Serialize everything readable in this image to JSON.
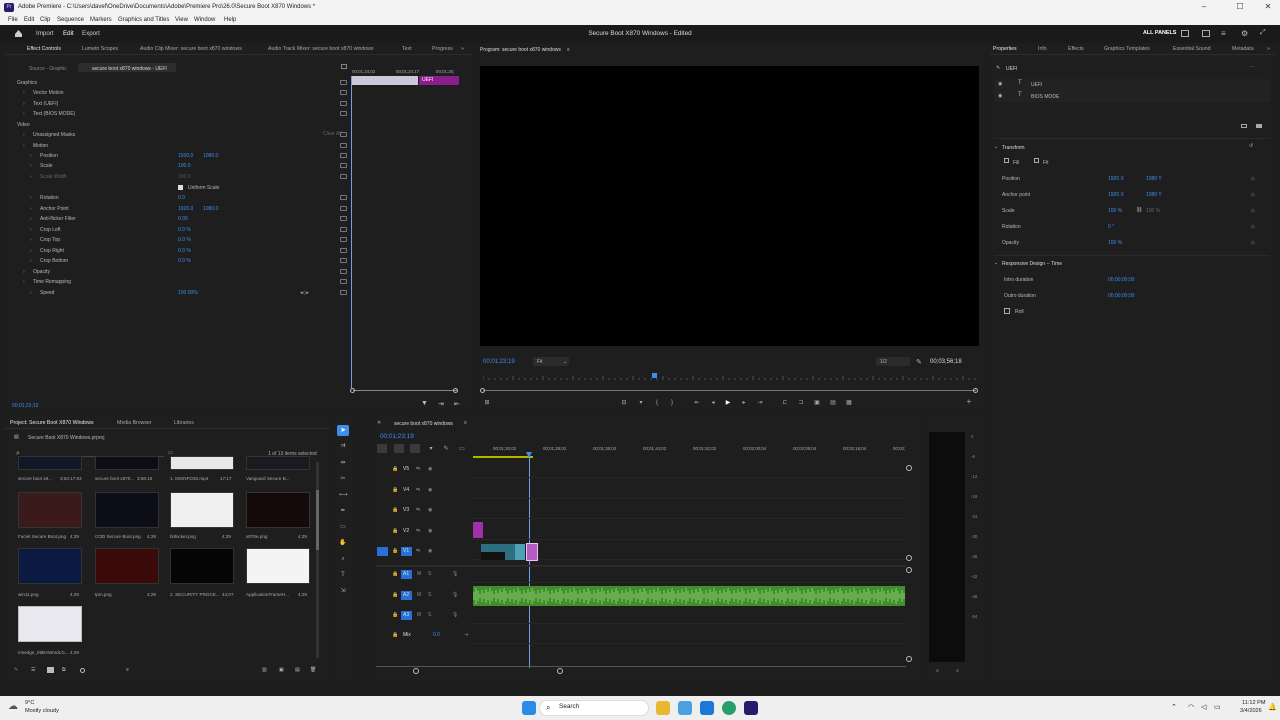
{
  "window": {
    "title": "Adobe Premiere - C:\\Users\\davef\\OneDrive\\Documents\\Adobe\\Premiere Pro\\26.0\\Secure Boot X870 Windows *",
    "app_icon": "Pr"
  },
  "menu": [
    "File",
    "Edit",
    "Clip",
    "Sequence",
    "Markers",
    "Graphics and Titles",
    "View",
    "Window",
    "Help"
  ],
  "header": {
    "tabs": [
      "Import",
      "Edit",
      "Export"
    ],
    "project_title": "Secure Boot X870 Windows - Edited",
    "all_panels": "ALL PANELS"
  },
  "effect_controls": {
    "tabs": [
      "Effect Controls",
      "Lumetri Scopes",
      "Audio Clip Mixer: secure boot x870 windows",
      "Audio Track Mixer: secure boot x870 windows",
      "Text",
      "Progress"
    ],
    "source": "Source - Graphic",
    "clip": "secure boot x870 windows - UEFI",
    "timecodes": [
      "00;01;24;02",
      "00;01;24;17",
      "00;01;25;"
    ],
    "clip_label": "UEFI",
    "rows": [
      {
        "label": "Graphics",
        "indent": 0
      },
      {
        "label": "Vector Motion",
        "indent": 1
      },
      {
        "label": "Text (UEFI)",
        "indent": 1
      },
      {
        "label": "Text (BIOS MODE)",
        "indent": 1
      },
      {
        "label": "Video",
        "indent": 0
      },
      {
        "label": "Unassigned Masks",
        "indent": 1
      },
      {
        "label": "Motion",
        "indent": 1
      },
      {
        "label": "Position",
        "indent": 2,
        "v1": "1920.0",
        "v2": "1080.0"
      },
      {
        "label": "Scale",
        "indent": 2,
        "v1": "100.0"
      },
      {
        "label": "Scale Width",
        "indent": 2,
        "v1": "100.0",
        "dim": true
      },
      {
        "label": "",
        "indent": 2,
        "check": "Uniform Scale"
      },
      {
        "label": "Rotation",
        "indent": 2,
        "v1": "0.0"
      },
      {
        "label": "Anchor Point",
        "indent": 2,
        "v1": "1920.0",
        "v2": "1080.0"
      },
      {
        "label": "Anti-flicker Filter",
        "indent": 2,
        "v1": "0.00"
      },
      {
        "label": "Crop Left",
        "indent": 2,
        "v1": "0.0 %"
      },
      {
        "label": "Crop Top",
        "indent": 2,
        "v1": "0.0 %"
      },
      {
        "label": "Crop Right",
        "indent": 2,
        "v1": "0.0 %"
      },
      {
        "label": "Crop Bottom",
        "indent": 2,
        "v1": "0.0 %"
      },
      {
        "label": "Opacity",
        "indent": 1
      },
      {
        "label": "Time Remapping",
        "indent": 1
      },
      {
        "label": "Speed",
        "indent": 2,
        "v1": "100.00%"
      }
    ],
    "clear_all": "Clear All",
    "footer_time": "00;01;23;19"
  },
  "program": {
    "title": "Program: secure boot x870 windows",
    "timecode": "00;01;23;19",
    "fit": "Fit",
    "quality": "1/2",
    "duration": "00;03;56;18"
  },
  "properties": {
    "tabs": [
      "Properties",
      "Info",
      "Effects",
      "Graphics Templates",
      "Essential Sound",
      "Metadata"
    ],
    "layer_group": "UEFI",
    "layers": [
      "UEFI",
      "BIOS MODE"
    ],
    "transform_title": "Transform",
    "fill_label": "Fill",
    "fit_label": "Fit",
    "transform": [
      {
        "label": "Position",
        "v1": "1920 X",
        "v2": "1080 Y"
      },
      {
        "label": "Anchor point",
        "v1": "1920 X",
        "v2": "1080 Y"
      },
      {
        "label": "Scale",
        "v1": "100 %",
        "v2": "100 %"
      },
      {
        "label": "Rotation",
        "v1": "0 °"
      },
      {
        "label": "Opacity",
        "v1": "100 %"
      }
    ],
    "responsive_title": "Responsive Design -- Time",
    "responsive": [
      {
        "label": "Intro duration",
        "v1": "00;00;00;00"
      },
      {
        "label": "Outro duration",
        "v1": "00;00;00;00"
      }
    ],
    "roll": "Roll"
  },
  "project": {
    "tabs": [
      "Project: Secure Boot X870 Windows",
      "Media Browser",
      "Libraries"
    ],
    "file": "Secure Boot X870 Windows.prproj",
    "selection": "1 of 13 items selected",
    "items": [
      {
        "name": "secure boot x8...",
        "dur": "3;54;17;04"
      },
      {
        "name": "secure boot x870...",
        "dur": "3;56;18"
      },
      {
        "name": "1. MSINFO32.mp4",
        "dur": "17;17"
      },
      {
        "name": "Vanguard Secure B...",
        "dur": "4;29"
      },
      {
        "name": "Faceit Secure Boot.png",
        "dur": "4;29"
      },
      {
        "name": "COD Secure Boot.png",
        "dur": "4;29"
      },
      {
        "name": "bitlocker.png",
        "dur": "4;29"
      },
      {
        "name": "x870e.png",
        "dur": "4;29"
      },
      {
        "name": "win11.png",
        "dur": "4;29"
      },
      {
        "name": "tpm.png",
        "dur": "4;29"
      },
      {
        "name": "2. SECURITY PROCE...",
        "dur": "44;07"
      },
      {
        "name": "ApplicationFrameH...",
        "dur": "4;29"
      },
      {
        "name": "msedge_rl8BAWmdLG...",
        "dur": "4;29"
      }
    ]
  },
  "timeline": {
    "title": "secure boot x870 windows",
    "timecode": "00;01;23;19",
    "ruler": [
      "00;01;20;02",
      "00;01;28;02",
      "00;01;36;02",
      "00;01;44;02",
      "00;01;52;02",
      "00;02;00;04",
      "00;02;08;04",
      "00;02;16;04",
      "00;02;"
    ],
    "tracks": [
      "V5",
      "V4",
      "V3",
      "V2",
      "V1",
      "A1",
      "A2",
      "A3",
      "Mix"
    ],
    "mix_value": "0.0",
    "meter_ticks": [
      "0",
      "-6",
      "-12",
      "-18",
      "-24",
      "-30",
      "-36",
      "-42",
      "-48",
      "-54"
    ],
    "meter_bottom": [
      "S",
      "S"
    ]
  },
  "taskbar": {
    "weather_temp": "9°C",
    "weather_desc": "Mostly cloudy",
    "search": "Search",
    "time": "11:12 PM",
    "date": "3/4/2026"
  }
}
